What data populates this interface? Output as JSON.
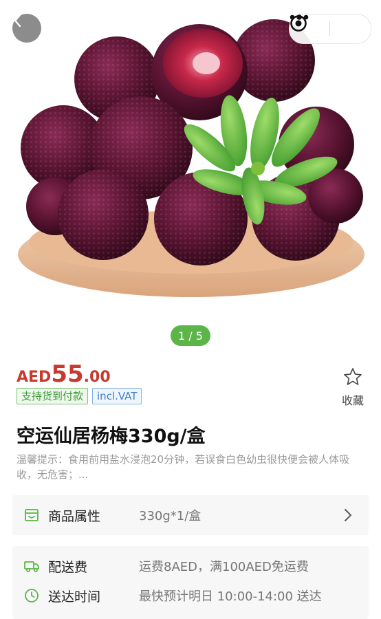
{
  "nav": {
    "back_icon": "chevron-left-icon",
    "more_icon": "more-dots-icon",
    "close_icon": "target-circle-icon"
  },
  "gallery": {
    "image_subject": "bayberries on a wooden plate with green leaves",
    "pager_text": "1 / 5",
    "pager_color": "#5bb547"
  },
  "price": {
    "currency": "AED",
    "integer": "55",
    "decimal": ".00",
    "color": "#c63a2f"
  },
  "tags": {
    "cod": "支持货到付款",
    "vat": "incl.VAT"
  },
  "favorite": {
    "label": "收藏",
    "icon": "star-outline-icon"
  },
  "product": {
    "title": "空运仙居杨梅330g/盒",
    "tip": "温馨提示：食用前用盐水浸泡20分钟，若误食白色幼虫很快便会被人体吸收，无危害；..."
  },
  "attributes": {
    "label": "商品属性",
    "value": "330g*1/盒",
    "icon": "box-icon"
  },
  "shipping": {
    "label": "配送费",
    "value": "运费8AED，满100AED免运费",
    "icon": "truck-icon"
  },
  "delivery": {
    "label": "送达时间",
    "value": "最快预计明日 10:00-14:00 送达",
    "icon": "clock-icon"
  }
}
